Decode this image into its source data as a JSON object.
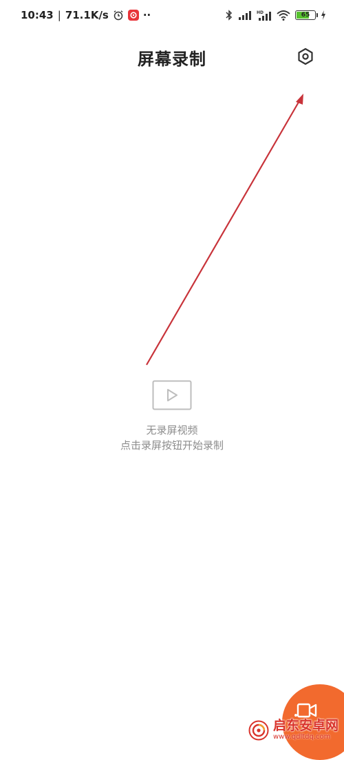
{
  "status_bar": {
    "time": "10:43",
    "separator": "|",
    "net_speed": "71.1K/s",
    "dots": "··",
    "battery_level": "65",
    "icons": [
      "alarm-icon",
      "app-badge-icon",
      "bluetooth-icon",
      "signal-icon",
      "hd-signal-icon",
      "wifi-icon",
      "battery-icon",
      "charging-icon"
    ]
  },
  "header": {
    "title": "屏幕录制",
    "settings_icon": "gear-icon"
  },
  "empty_state": {
    "icon": "video-play-icon",
    "title": "无录屏视频",
    "subtitle": "点击录屏按钮开始录制"
  },
  "fab": {
    "icon": "video-camera-icon",
    "color": "#f26a2e"
  },
  "watermark": {
    "name": "启东安卓网",
    "url": "www.qdltdq.com"
  },
  "colors": {
    "accent": "#f26a2e",
    "annotation_arrow": "#c8333a",
    "muted_text": "#8c8c8c"
  }
}
